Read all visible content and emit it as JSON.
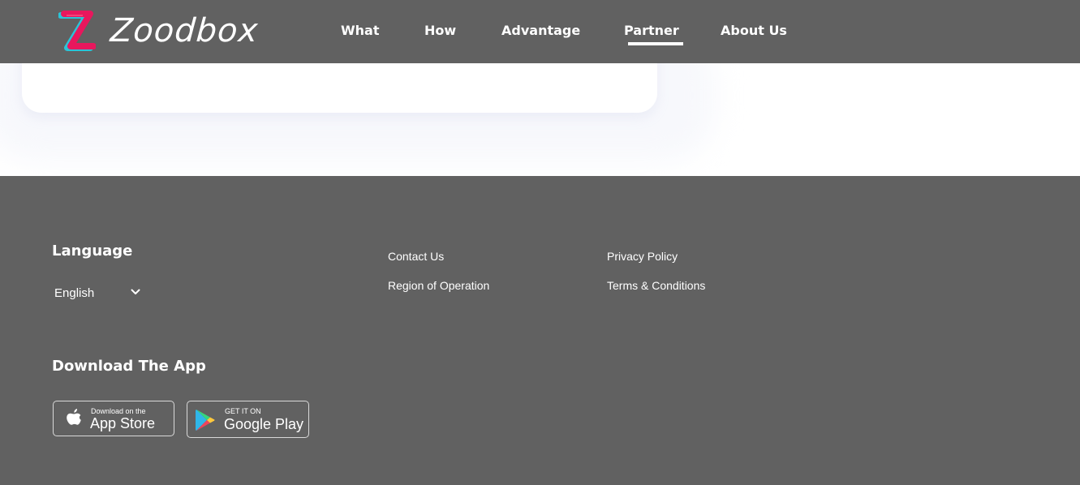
{
  "brand": {
    "name": "Zoodbox",
    "logo_letter": "Z"
  },
  "nav": {
    "items": [
      {
        "label": "What",
        "active": false
      },
      {
        "label": "How",
        "active": false
      },
      {
        "label": "Advantage",
        "active": false
      },
      {
        "label": "Partner",
        "active": true
      },
      {
        "label": "About Us",
        "active": false
      }
    ]
  },
  "footer": {
    "language": {
      "heading": "Language",
      "selected": "English",
      "icon": "chevron-down-icon"
    },
    "links_col1": [
      "Contact Us",
      "Region of Operation"
    ],
    "links_col2": [
      "Privacy Policy",
      "Terms & Conditions"
    ],
    "download": {
      "heading": "Download The App",
      "app_store": {
        "small": "Download on the",
        "big": "App Store",
        "icon": "apple-icon"
      },
      "google_play": {
        "small": "GET IT ON",
        "big": "Google Play",
        "icon": "google-play-icon"
      }
    }
  },
  "colors": {
    "header_bg": "#616161",
    "footer_bg": "#616161",
    "logo_pink": "#e8175d",
    "logo_cyan": "#2bc4d8",
    "text": "#ffffff"
  }
}
